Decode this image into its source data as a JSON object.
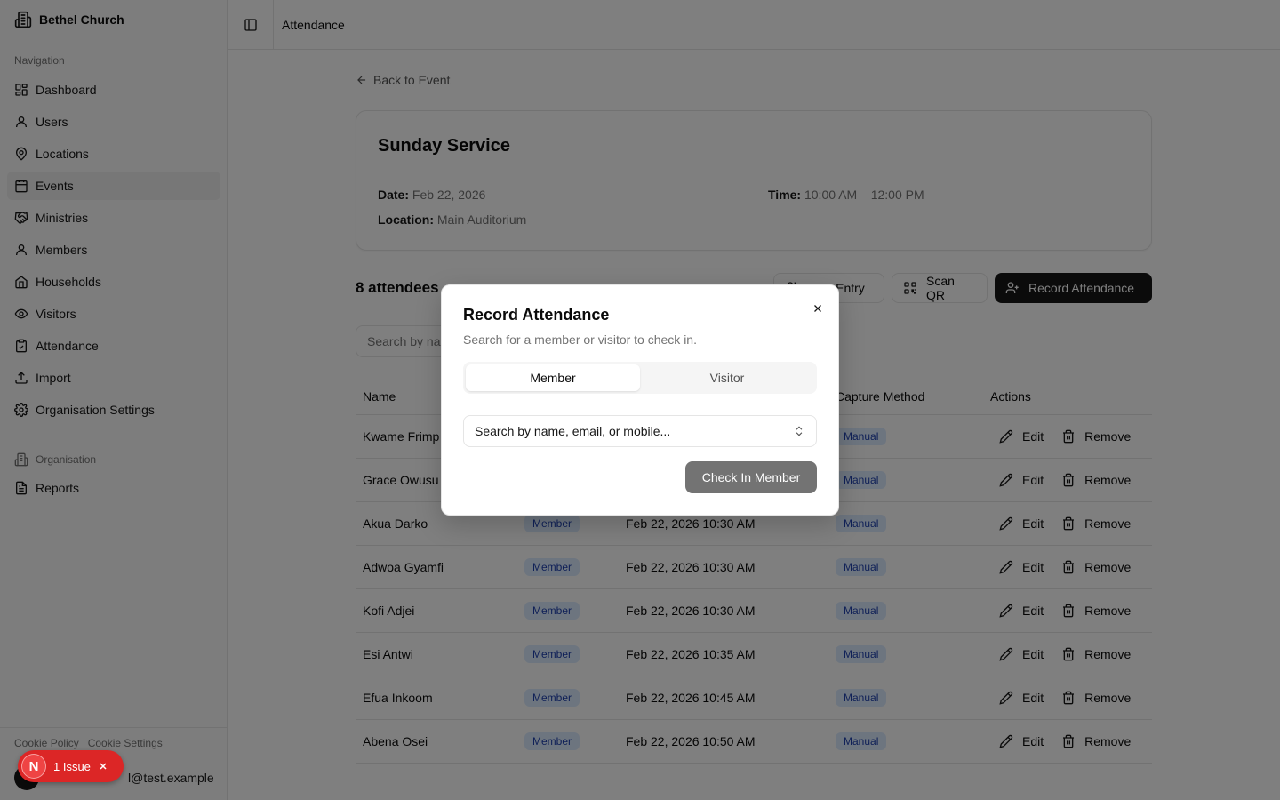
{
  "sidebar": {
    "brand": "Bethel Church",
    "nav_label": "Navigation",
    "items": [
      {
        "label": "Dashboard",
        "icon": "dashboard-icon",
        "active": false
      },
      {
        "label": "Users",
        "icon": "user-icon",
        "active": false
      },
      {
        "label": "Locations",
        "icon": "map-pin-icon",
        "active": false
      },
      {
        "label": "Events",
        "icon": "calendar-icon",
        "active": true
      },
      {
        "label": "Ministries",
        "icon": "handshake-icon",
        "active": false
      },
      {
        "label": "Members",
        "icon": "user-icon",
        "active": false
      },
      {
        "label": "Households",
        "icon": "home-icon",
        "active": false
      },
      {
        "label": "Visitors",
        "icon": "eye-icon",
        "active": false
      },
      {
        "label": "Attendance",
        "icon": "clipboard-check-icon",
        "active": false
      },
      {
        "label": "Import",
        "icon": "upload-icon",
        "active": false
      },
      {
        "label": "Organisation Settings",
        "icon": "gear-icon",
        "active": false
      }
    ],
    "org_label": "Organisation",
    "org_items": [
      {
        "label": "Reports",
        "icon": "file-text-icon"
      }
    ],
    "footer": {
      "cookie_policy": "Cookie Policy",
      "cookie_settings": "Cookie Settings",
      "email": "l@test.example"
    }
  },
  "header": {
    "title": "Attendance"
  },
  "main": {
    "back_label": "Back to Event",
    "event": {
      "title": "Sunday Service",
      "date_label": "Date:",
      "date_value": "Feb 22, 2026",
      "time_label": "Time:",
      "time_value": "10:00 AM – 12:00 PM",
      "location_label": "Location:",
      "location_value": "Main Auditorium"
    },
    "attendee_count": "8 attendees",
    "attendee_sub": "(",
    "buttons": {
      "bulk": "Bulk Entry",
      "scan": "Scan QR",
      "record": "Record Attendance"
    },
    "search_placeholder": "Search by na",
    "table": {
      "headers": {
        "name": "Name",
        "type": "",
        "time": "",
        "method": "Capture Method",
        "actions": "Actions"
      },
      "edit_label": "Edit",
      "remove_label": "Remove",
      "rows": [
        {
          "name": "Kwame Frimp",
          "type": "",
          "time": "",
          "method": "Manual"
        },
        {
          "name": "Grace Owusu",
          "type": "",
          "time": "",
          "method": "Manual"
        },
        {
          "name": "Akua Darko",
          "type": "Member",
          "time": "Feb 22, 2026 10:30 AM",
          "method": "Manual"
        },
        {
          "name": "Adwoa Gyamfi",
          "type": "Member",
          "time": "Feb 22, 2026 10:30 AM",
          "method": "Manual"
        },
        {
          "name": "Kofi Adjei",
          "type": "Member",
          "time": "Feb 22, 2026 10:30 AM",
          "method": "Manual"
        },
        {
          "name": "Esi Antwi",
          "type": "Member",
          "time": "Feb 22, 2026 10:35 AM",
          "method": "Manual"
        },
        {
          "name": "Efua Inkoom",
          "type": "Member",
          "time": "Feb 22, 2026 10:45 AM",
          "method": "Manual"
        },
        {
          "name": "Abena Osei",
          "type": "Member",
          "time": "Feb 22, 2026 10:50 AM",
          "method": "Manual"
        }
      ]
    }
  },
  "dialog": {
    "title": "Record Attendance",
    "description": "Search for a member or visitor to check in.",
    "tabs": [
      "Member",
      "Visitor"
    ],
    "active_tab": 0,
    "search_placeholder": "Search by name, email, or mobile...",
    "submit_label": "Check In Member"
  },
  "issue_badge": {
    "letter": "N",
    "text": "1 Issue"
  },
  "colors": {
    "accent": "#171717",
    "badge_bg": "#dbeafe",
    "badge_text": "#1e40af",
    "issue_red": "#dc2626"
  }
}
